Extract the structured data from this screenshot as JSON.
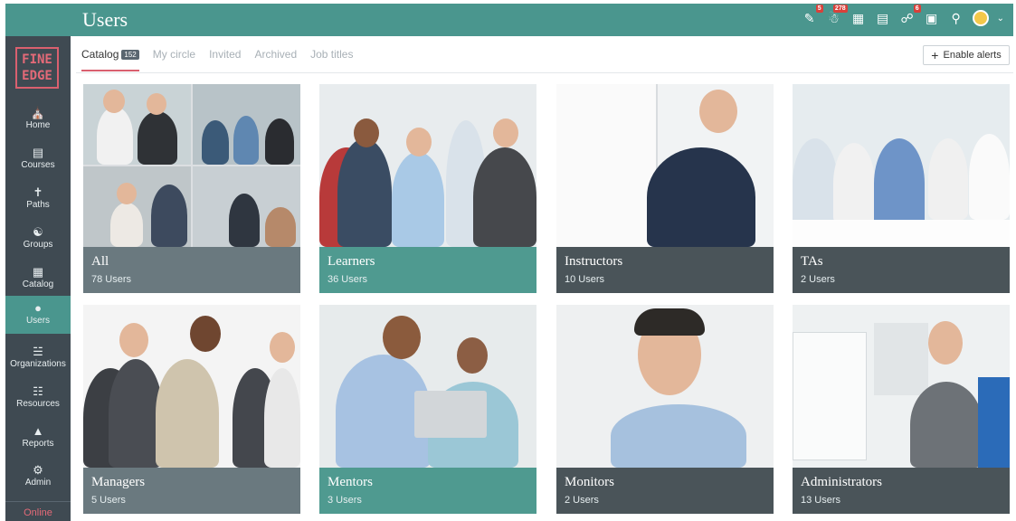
{
  "header": {
    "title": "Users",
    "badges": {
      "notifications": "5",
      "messages": "278",
      "cart": "6"
    }
  },
  "sidebar": {
    "logo_line1": "FINE",
    "logo_line2": "EDGE",
    "items": [
      {
        "label": "Home",
        "icon": "home-icon"
      },
      {
        "label": "Courses",
        "icon": "book-icon"
      },
      {
        "label": "Paths",
        "icon": "signpost-icon"
      },
      {
        "label": "Groups",
        "icon": "groups-icon"
      },
      {
        "label": "Catalog",
        "icon": "grid-icon"
      },
      {
        "label": "Users",
        "icon": "user-icon"
      },
      {
        "label": "Organizations",
        "icon": "org-icon"
      },
      {
        "label": "Resources",
        "icon": "resources-icon"
      },
      {
        "label": "Reports",
        "icon": "reports-icon"
      },
      {
        "label": "Admin",
        "icon": "gear-icon"
      }
    ],
    "online": "Online"
  },
  "tabs": [
    {
      "label": "Catalog",
      "count": "152"
    },
    {
      "label": "My circle"
    },
    {
      "label": "Invited"
    },
    {
      "label": "Archived"
    },
    {
      "label": "Job titles"
    }
  ],
  "actions": {
    "enable_alerts": "Enable alerts"
  },
  "cards": [
    {
      "name": "All",
      "count": "78 Users"
    },
    {
      "name": "Learners",
      "count": "36 Users"
    },
    {
      "name": "Instructors",
      "count": "10 Users"
    },
    {
      "name": "TAs",
      "count": "2 Users"
    },
    {
      "name": "Managers",
      "count": "5 Users"
    },
    {
      "name": "Mentors",
      "count": "3 Users"
    },
    {
      "name": "Monitors",
      "count": "2 Users"
    },
    {
      "name": "Administrators",
      "count": "13 Users"
    }
  ],
  "colors": {
    "accent": "#4a968e",
    "sidebar": "#3f4a52",
    "brand": "#d9606f"
  }
}
